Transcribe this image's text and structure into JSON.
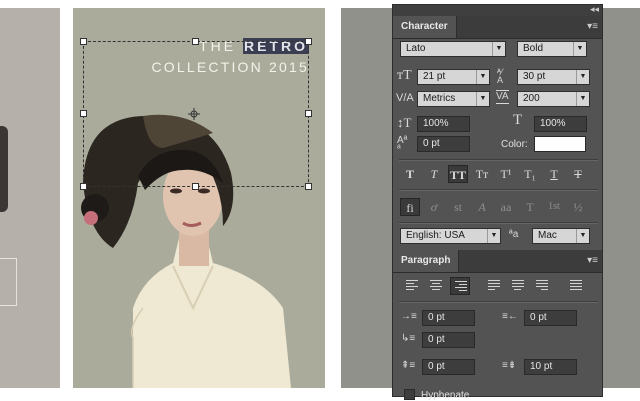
{
  "artwork": {
    "headline_prefix": "THE",
    "headline_selected": "RETRO",
    "headline_line2": "COLLECTION 2015"
  },
  "character_panel": {
    "tab_label": "Character",
    "font_family": "Lato",
    "font_style": "Bold",
    "font_size": "21 pt",
    "leading": "30 pt",
    "kerning": "Metrics",
    "tracking": "200",
    "vertical_scale": "100%",
    "horizontal_scale": "100%",
    "baseline_shift": "0 pt",
    "color_label": "Color:",
    "color_value": "#ffffff",
    "style_buttons": [
      "T",
      "T",
      "TT",
      "Tт",
      "T¹",
      "T₁",
      "T",
      "T"
    ],
    "opentype_buttons": [
      "fi",
      "ơ",
      "st",
      "A",
      "aa",
      "T",
      "1st",
      "½"
    ],
    "language": "English: USA",
    "aa_icon_text": "ªa",
    "antialias": "Mac"
  },
  "paragraph_panel": {
    "tab_label": "Paragraph",
    "indent_left": "0 pt",
    "indent_right": "0 pt",
    "indent_first": "0 pt",
    "space_before": "0 pt",
    "space_after": "10 pt",
    "hyphenate_label": "Hyphenate"
  }
}
